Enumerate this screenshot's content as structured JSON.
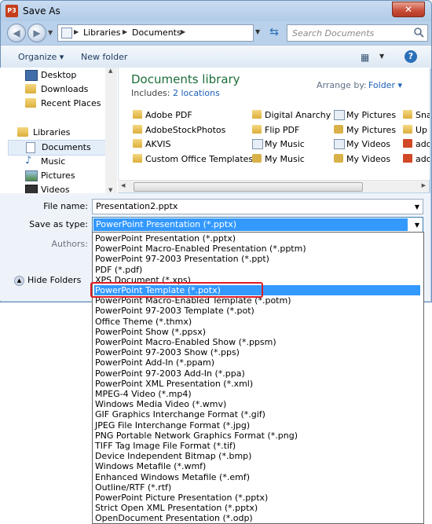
{
  "window": {
    "title": "Save As",
    "app_icon": "P3",
    "close_glyph": "✕"
  },
  "address": {
    "crumbs": [
      "Libraries",
      "Documents"
    ],
    "search_placeholder": "Search Documents"
  },
  "toolbar": {
    "organize": "Organize ▾",
    "new_folder": "New folder",
    "help": "?"
  },
  "nav": {
    "items": [
      {
        "label": "Desktop",
        "icon": "desktop-icon"
      },
      {
        "label": "Downloads",
        "icon": "downloads-icon"
      },
      {
        "label": "Recent Places",
        "icon": "recent-places-icon"
      },
      {
        "label": "Libraries",
        "icon": "libraries-icon"
      },
      {
        "label": "Documents",
        "icon": "documents-icon"
      },
      {
        "label": "Music",
        "icon": "music-icon"
      },
      {
        "label": "Pictures",
        "icon": "pictures-icon"
      },
      {
        "label": "Videos",
        "icon": "videos-icon"
      }
    ]
  },
  "library": {
    "title": "Documents library",
    "includes_label": "Includes:",
    "includes_link": "2 locations",
    "arrange_label": "Arrange by:",
    "arrange_value": "Folder ▾"
  },
  "files": {
    "col1": [
      "Adobe PDF",
      "AdobeStockPhotos",
      "AKVIS",
      "Custom Office Templates"
    ],
    "col2": [
      "Digital Anarchy",
      "Flip PDF",
      "My Music",
      "My Music"
    ],
    "col3": [
      "My Pictures",
      "My Pictures",
      "My Videos",
      "My Videos"
    ],
    "col4": [
      "Sna",
      "Up",
      "ado",
      "ado"
    ]
  },
  "form": {
    "filename_label": "File name:",
    "filename_value": "Presentation2.pptx",
    "savetype_label": "Save as type:",
    "savetype_value": "PowerPoint Presentation (*.pptx)",
    "authors_label": "Authors:",
    "hide_folders": "Hide Folders"
  },
  "dropdown": {
    "options": [
      "PowerPoint Presentation (*.pptx)",
      "PowerPoint Macro-Enabled Presentation (*.pptm)",
      "PowerPoint 97-2003 Presentation (*.ppt)",
      "PDF (*.pdf)",
      "XPS Document (*.xps)",
      "PowerPoint Template (*.potx)",
      "PowerPoint Macro-Enabled Template (*.potm)",
      "PowerPoint 97-2003 Template (*.pot)",
      "Office Theme (*.thmx)",
      "PowerPoint Show (*.ppsx)",
      "PowerPoint Macro-Enabled Show (*.ppsm)",
      "PowerPoint 97-2003 Show (*.pps)",
      "PowerPoint Add-In (*.ppam)",
      "PowerPoint 97-2003 Add-In (*.ppa)",
      "PowerPoint XML Presentation (*.xml)",
      "MPEG-4 Video (*.mp4)",
      "Windows Media Video (*.wmv)",
      "GIF Graphics Interchange Format (*.gif)",
      "JPEG File Interchange Format (*.jpg)",
      "PNG Portable Network Graphics Format (*.png)",
      "TIFF Tag Image File Format (*.tif)",
      "Device Independent Bitmap (*.bmp)",
      "Windows Metafile (*.wmf)",
      "Enhanced Windows Metafile (*.emf)",
      "Outline/RTF (*.rtf)",
      "PowerPoint Picture Presentation (*.pptx)",
      "Strict Open XML Presentation (*.pptx)",
      "OpenDocument Presentation (*.odp)"
    ],
    "highlighted_index": 5,
    "highlight_color": "#3399ff",
    "callout_color": "#e01b24"
  }
}
